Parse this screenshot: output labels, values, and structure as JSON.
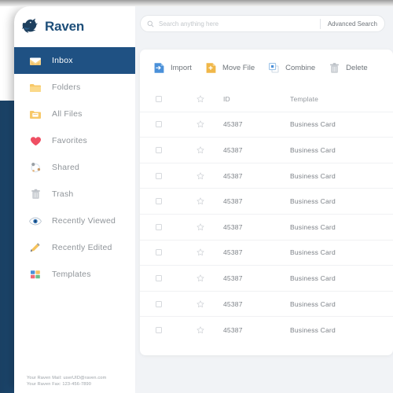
{
  "brand": {
    "name": "Raven",
    "logo_icon": "raven-bird-icon",
    "navy": "#1f4e79",
    "accent_blue": "#4a90d9",
    "accent_orange": "#f4b63f"
  },
  "sidebar": {
    "items": [
      {
        "label": "Inbox",
        "icon": "inbox-envelope-icon",
        "active": true
      },
      {
        "label": "Folders",
        "icon": "folder-icon",
        "active": false
      },
      {
        "label": "All Files",
        "icon": "all-files-icon",
        "active": false
      },
      {
        "label": "Favorites",
        "icon": "heart-icon",
        "active": false
      },
      {
        "label": "Shared",
        "icon": "share-nodes-icon",
        "active": false
      },
      {
        "label": "Trash",
        "icon": "trash-icon",
        "active": false
      },
      {
        "label": "Recently Viewed",
        "icon": "eye-icon",
        "active": false
      },
      {
        "label": "Recently Edited",
        "icon": "pencil-icon",
        "active": false
      },
      {
        "label": "Templates",
        "icon": "templates-grid-icon",
        "active": false
      }
    ],
    "footer": {
      "mail_line": "Your Raven Mail:  userUID@raven.com",
      "fax_line": "Your Raven Fax:  123-456-7890"
    }
  },
  "search": {
    "placeholder": "Search anything here",
    "value": "",
    "icon": "search-icon",
    "advanced_label": "Advanced Search"
  },
  "toolbar": {
    "buttons": [
      {
        "label": "Import",
        "icon": "import-icon"
      },
      {
        "label": "Move File",
        "icon": "move-file-icon"
      },
      {
        "label": "Combine",
        "icon": "combine-icon"
      },
      {
        "label": "Delete",
        "icon": "delete-trash-icon"
      }
    ]
  },
  "table": {
    "headers": {
      "id": "ID",
      "template": "Template"
    },
    "rows": [
      {
        "id": "45387",
        "template": "Business Card"
      },
      {
        "id": "45387",
        "template": "Business Card"
      },
      {
        "id": "45387",
        "template": "Business Card"
      },
      {
        "id": "45387",
        "template": "Business Card"
      },
      {
        "id": "45387",
        "template": "Business Card"
      },
      {
        "id": "45387",
        "template": "Business Card"
      },
      {
        "id": "45387",
        "template": "Business Card"
      },
      {
        "id": "45387",
        "template": "Business Card"
      },
      {
        "id": "45387",
        "template": "Business Card"
      }
    ]
  }
}
